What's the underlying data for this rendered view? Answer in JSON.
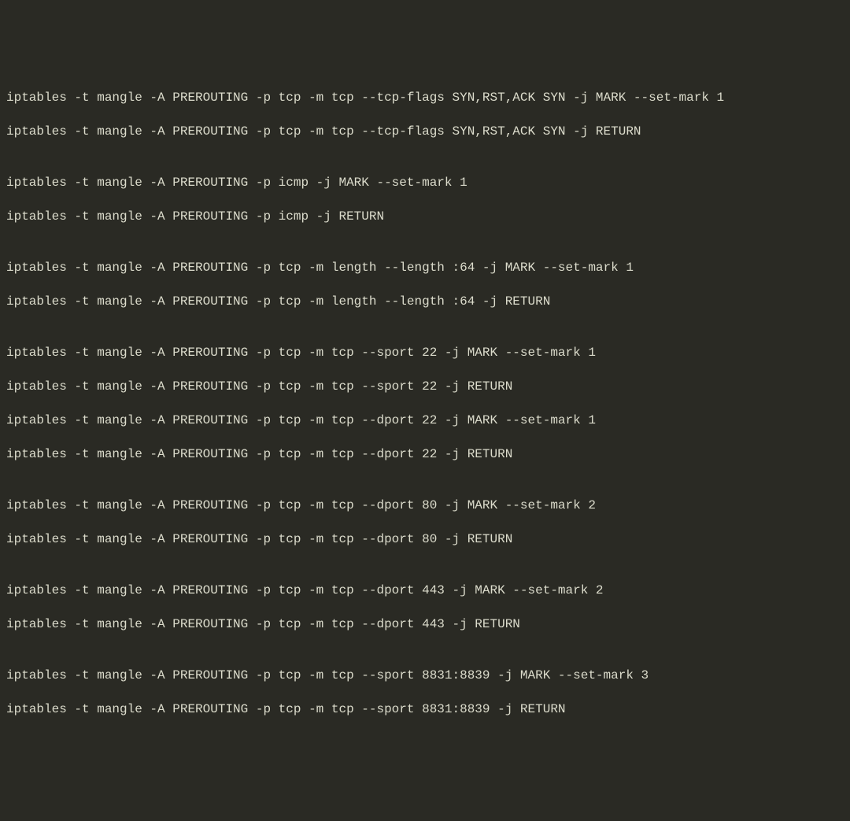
{
  "terminal": {
    "lines": [
      "iptables -t mangle -A PREROUTING -p tcp -m tcp --tcp-flags SYN,RST,ACK SYN -j MARK --set-mark 1",
      "iptables -t mangle -A PREROUTING -p tcp -m tcp --tcp-flags SYN,RST,ACK SYN -j RETURN",
      "",
      "iptables -t mangle -A PREROUTING -p icmp -j MARK --set-mark 1",
      "iptables -t mangle -A PREROUTING -p icmp -j RETURN",
      "",
      "iptables -t mangle -A PREROUTING -p tcp -m length --length :64 -j MARK --set-mark 1",
      "iptables -t mangle -A PREROUTING -p tcp -m length --length :64 -j RETURN",
      "",
      "iptables -t mangle -A PREROUTING -p tcp -m tcp --sport 22 -j MARK --set-mark 1",
      "iptables -t mangle -A PREROUTING -p tcp -m tcp --sport 22 -j RETURN",
      "iptables -t mangle -A PREROUTING -p tcp -m tcp --dport 22 -j MARK --set-mark 1",
      "iptables -t mangle -A PREROUTING -p tcp -m tcp --dport 22 -j RETURN",
      "",
      "iptables -t mangle -A PREROUTING -p tcp -m tcp --dport 80 -j MARK --set-mark 2",
      "iptables -t mangle -A PREROUTING -p tcp -m tcp --dport 80 -j RETURN",
      "",
      "iptables -t mangle -A PREROUTING -p tcp -m tcp --dport 443 -j MARK --set-mark 2",
      "iptables -t mangle -A PREROUTING -p tcp -m tcp --dport 443 -j RETURN",
      "",
      "iptables -t mangle -A PREROUTING -p tcp -m tcp --sport 8831:8839 -j MARK --set-mark 3",
      "iptables -t mangle -A PREROUTING -p tcp -m tcp --sport 8831:8839 -j RETURN"
    ]
  }
}
